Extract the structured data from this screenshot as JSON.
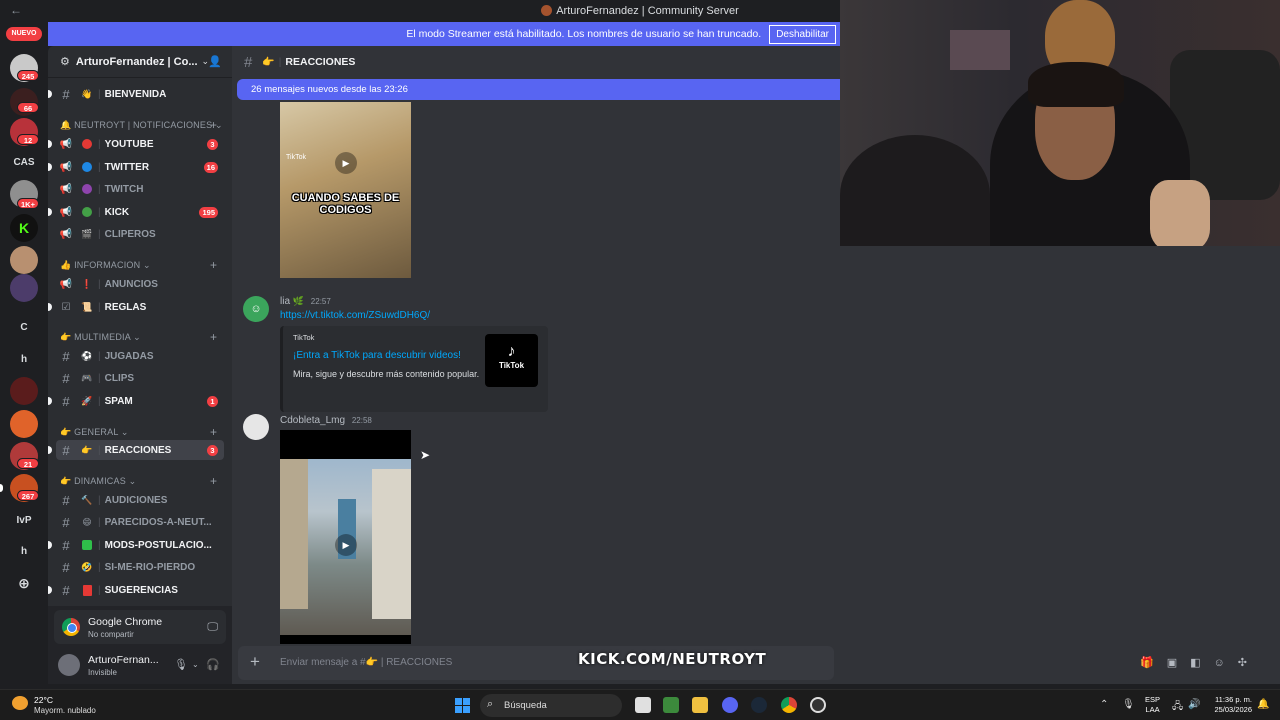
{
  "window": {
    "title": "ArturoFernandez | Community Server",
    "back_icon": "arrow-left-icon"
  },
  "banner": {
    "text": "El modo Streamer está habilitado. Los nombres de usuario se han truncado.",
    "button": "Deshabilitar"
  },
  "rail": {
    "new_label": "NUEVO",
    "badges": [
      "245",
      "66",
      "12",
      "1K+",
      "21",
      "267"
    ],
    "text_servers": [
      "CAS",
      "C",
      "h",
      "IvP",
      "h"
    ]
  },
  "server": {
    "name": "ArturoFernandez | Co...",
    "chevron": "chevron-down-icon"
  },
  "categories": {
    "notificaciones": "🔔 NEUTROYT | NOTIFICACIONES",
    "informacion": "👍 INFORMACION",
    "multimedia": "👉 MULTIMEDIA",
    "general": "👉 GENERAL",
    "dinamicas": "👉 DINAMICAS"
  },
  "channels": {
    "bienvenida": "BIENVENIDA",
    "youtube": "YOUTUBE",
    "youtube_count": "3",
    "twitter": "TWITTER",
    "twitter_count": "16",
    "twitch": "TWITCH",
    "kick": "KICK",
    "kick_count": "195",
    "cliperos": "CLIPEROS",
    "anuncios": "ANUNCIOS",
    "reglas": "REGLAS",
    "jugadas": "JUGADAS",
    "clips": "CLIPS",
    "spam": "SPAM",
    "spam_count": "1",
    "reacciones": "REACCIONES",
    "reacciones_count": "3",
    "audiciones": "AUDICIONES",
    "parecidos": "PARECIDOS-A-NEUT...",
    "mods": "MODS-POSTULACIO...",
    "simerio": "SI-ME-RIO-PIERDO",
    "sugerencias": "SUGERENCIAS"
  },
  "user_panel": {
    "app_name": "Google Chrome",
    "app_status": "No compartir",
    "username": "ArturoFernan...",
    "status": "Invisible"
  },
  "chat": {
    "channel_name": "REACCIONES",
    "new_messages": "26 mensajes nuevos desde las 23:26",
    "video1_caption": "CUANDO SABES DE CODIGOS",
    "video1_tag": "TikTok",
    "msg1": {
      "author": "lia",
      "time": "22:57",
      "link": "https://vt.tiktok.com/ZSuwdDH6Q/",
      "embed_provider": "TikTok",
      "embed_title": "¡Entra a TikTok para descubrir videos!",
      "embed_desc": "Mira, sigue y descubre más contenido popular.",
      "embed_logo": "TikTok"
    },
    "msg2": {
      "author": "Cdobleta_Lmg",
      "time": "22:58"
    },
    "composer_placeholder": "Enviar mensaje a #👉 | REACCIONES"
  },
  "overlay": {
    "kick_prefix": "KICK.COM/",
    "kick_channel": "NEUTROYT"
  },
  "taskbar": {
    "temperature": "22°C",
    "weather": "Mayorm. nublado",
    "search": "Búsqueda",
    "lang1": "ESP",
    "lang2": "LAA",
    "time": "11:36 p. m.",
    "date": "25/03/2026"
  },
  "colors": {
    "blurple": "#5865f2",
    "unread_badge": "#f23f43",
    "link": "#00a8fc",
    "kick_green": "#53fc18"
  }
}
